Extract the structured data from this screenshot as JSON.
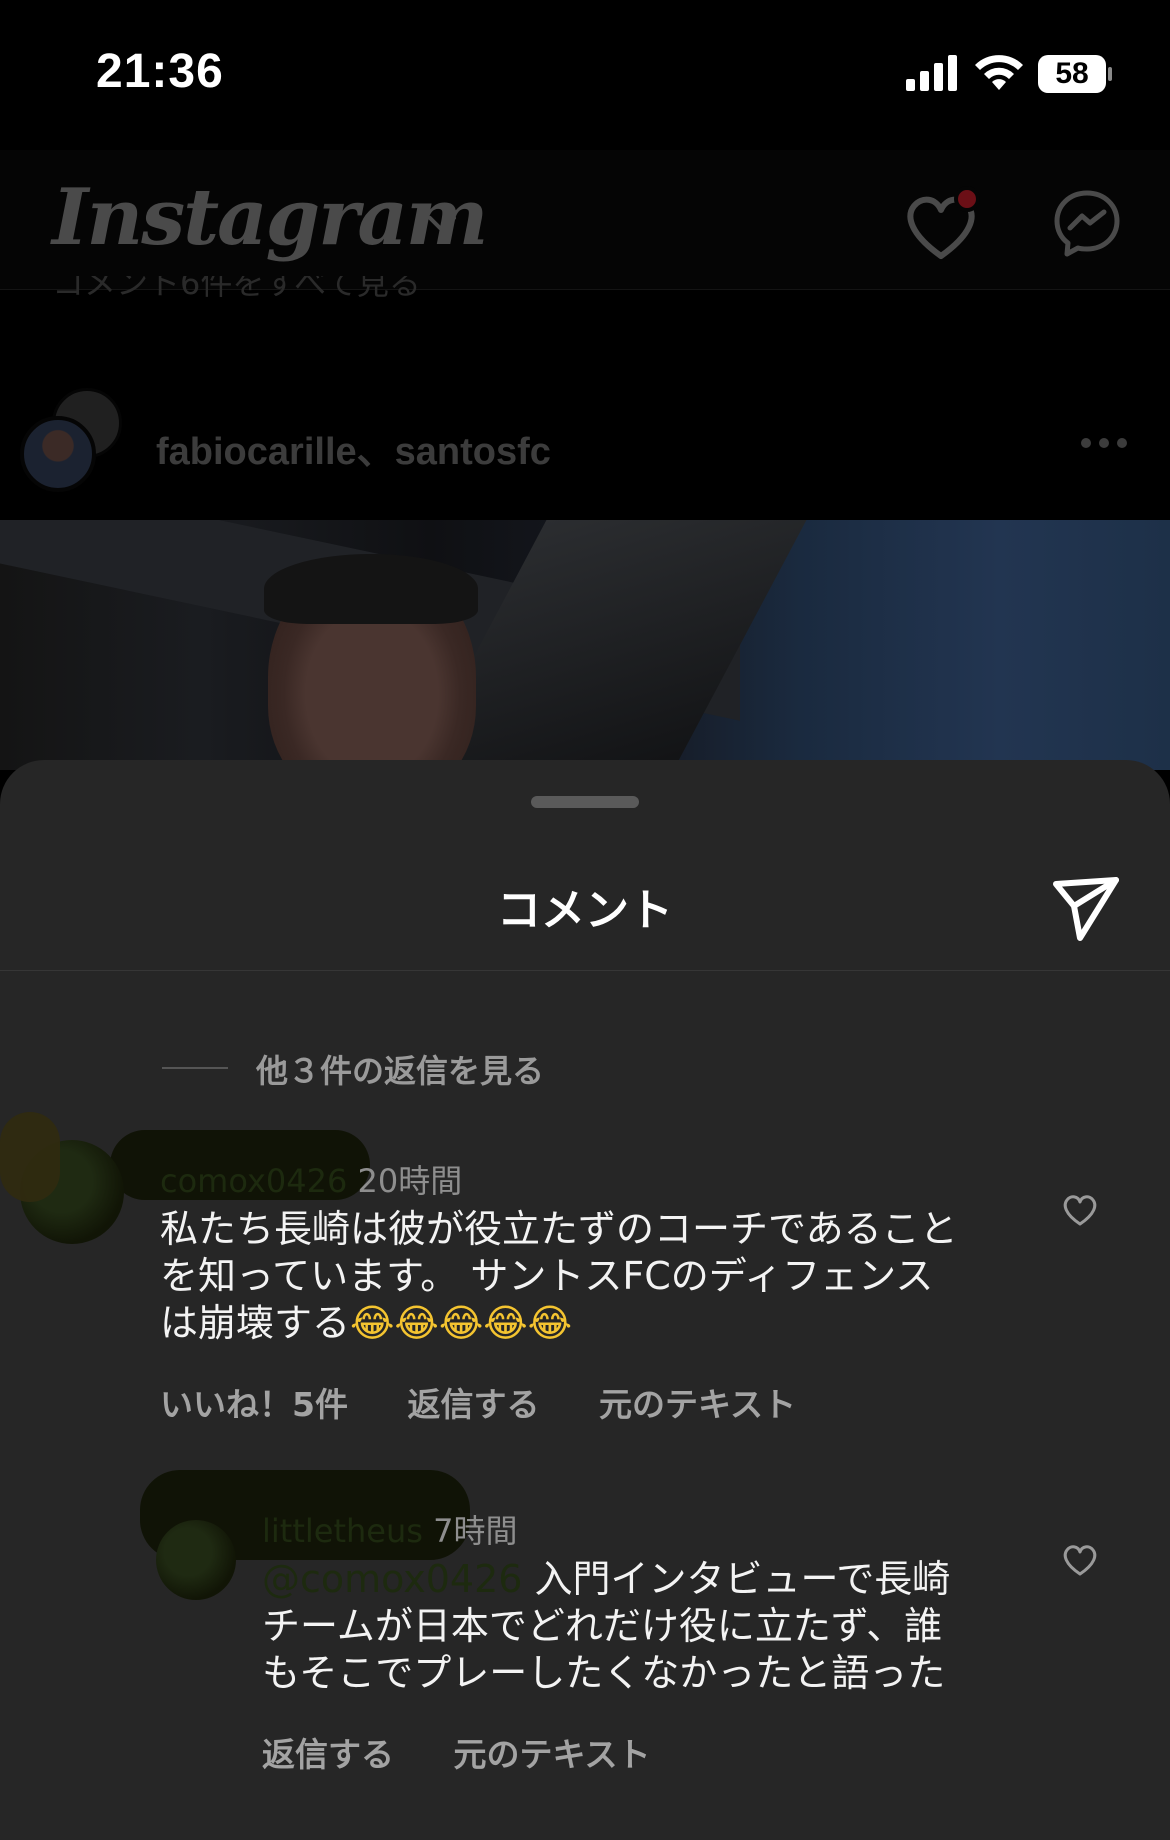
{
  "status_bar": {
    "time": "21:36",
    "battery": "58",
    "icons": [
      "signal-bars-icon",
      "wifi-icon",
      "battery-icon"
    ]
  },
  "header": {
    "logo": "Instagram",
    "icons": [
      "chevron-down-icon",
      "heart-icon",
      "messenger-icon"
    ]
  },
  "feed": {
    "peek_text": "コメント6件をすべて見る",
    "post_user": "fabiocarille、santosfc"
  },
  "sheet": {
    "title": "コメント",
    "view_replies": "他３件の返信を見る",
    "comments": [
      {
        "username": "comox0426",
        "time": "20時間",
        "text_lines": [
          "私たち長崎は彼が役立たずのコーチであること",
          "を知っています。 サントスFCのディフェンス",
          "は崩壊する"
        ],
        "emoji": "😂😂😂😂😂",
        "likes": "いいね！5件",
        "reply": "返信する",
        "see_original": "元のテキスト"
      },
      {
        "username": "littletheus",
        "time": "7時間",
        "mention": "@comox0426",
        "text_lines": [
          " 入門インタビューで長崎",
          "チームが日本でどれだけ役に立たず、誰",
          "もそこでプレーしたくなかったと語った"
        ],
        "reply": "返信する",
        "see_original": "元のテキスト"
      }
    ]
  },
  "colors": {
    "sheet_bg": "#262626",
    "background": "#000000",
    "notification": "#6b0f16"
  }
}
